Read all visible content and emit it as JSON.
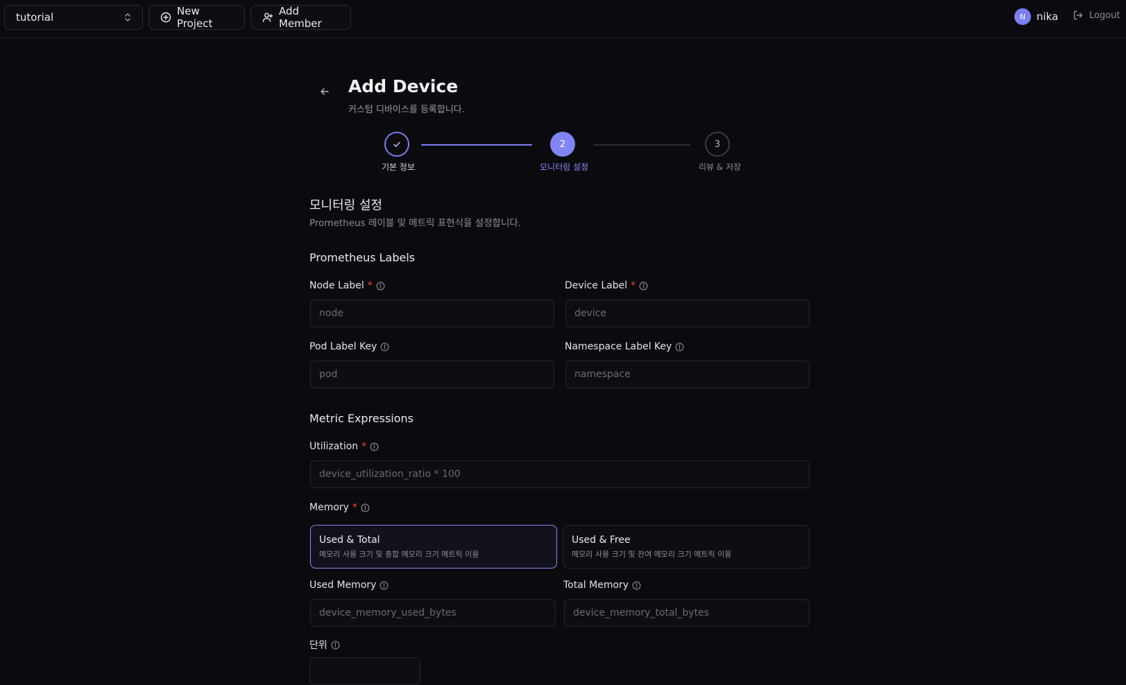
{
  "topbar": {
    "project": "tutorial",
    "new_project": "New Project",
    "add_member": "Add Member",
    "user_initial": "N",
    "user_name": "nika",
    "logout": "Logout"
  },
  "header": {
    "title": "Add Device",
    "subtitle": "커스텀 디바이스를 등록합니다."
  },
  "stepper": {
    "steps": [
      {
        "label": "기본 정보",
        "number": "1",
        "status": "complete"
      },
      {
        "label": "모니터링 설정",
        "number": "2",
        "status": "active"
      },
      {
        "label": "리뷰 & 저장",
        "number": "3",
        "status": "pending"
      }
    ]
  },
  "section": {
    "title": "모니터링 설정",
    "subtitle": "Prometheus 레이블 및 메트릭 표현식을 설정합니다."
  },
  "labels_section": {
    "heading": "Prometheus Labels",
    "node_label": {
      "label": "Node Label",
      "required": "*",
      "placeholder": "node"
    },
    "device_label": {
      "label": "Device Label",
      "required": "*",
      "placeholder": "device"
    },
    "pod_label_key": {
      "label": "Pod Label Key",
      "placeholder": "pod"
    },
    "namespace_label_key": {
      "label": "Namespace Label Key",
      "placeholder": "namespace"
    }
  },
  "metrics_section": {
    "heading": "Metric Expressions",
    "utilization": {
      "label": "Utilization",
      "required": "*",
      "placeholder": "device_utilization_ratio * 100"
    },
    "memory": {
      "label": "Memory",
      "required": "*",
      "options": [
        {
          "title": "Used & Total",
          "desc": "메모리 사용 크기 및 총합 메모리 크기 메트릭 이용",
          "selected": true
        },
        {
          "title": "Used & Free",
          "desc": "메모리 사용 크기 및 잔여 메모리 크기 메트릭 이용",
          "selected": false
        }
      ]
    },
    "used_memory": {
      "label": "Used Memory",
      "placeholder": "device_memory_used_bytes"
    },
    "total_memory": {
      "label": "Total Memory",
      "placeholder": "device_memory_total_bytes"
    },
    "unit": {
      "label": "단위"
    }
  },
  "colors": {
    "accent": "#8184f2",
    "required": "#ef4444",
    "background": "#0b0b0f"
  }
}
